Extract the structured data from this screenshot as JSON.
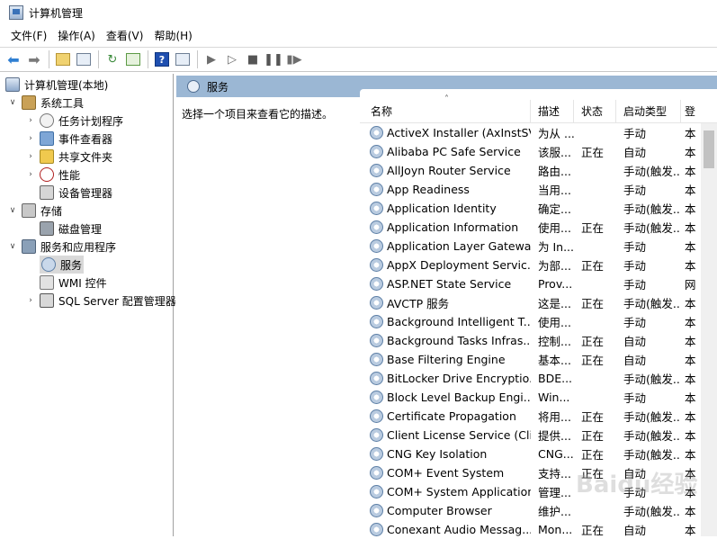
{
  "window": {
    "title": "计算机管理"
  },
  "menu": [
    "文件(F)",
    "操作(A)",
    "查看(V)",
    "帮助(H)"
  ],
  "tree": {
    "root": "计算机管理(本地)",
    "system_tools": "系统工具",
    "task_scheduler": "任务计划程序",
    "event_viewer": "事件查看器",
    "shared_folders": "共享文件夹",
    "performance": "性能",
    "device_manager": "设备管理器",
    "storage": "存储",
    "disk_management": "磁盘管理",
    "services_apps": "服务和应用程序",
    "services": "服务",
    "wmi": "WMI 控件",
    "sql_config": "SQL Server 配置管理器"
  },
  "pane": {
    "title": "服务",
    "description_hint": "选择一个项目来查看它的描述。"
  },
  "columns": {
    "name": "名称",
    "desc": "描述",
    "status": "状态",
    "startup": "启动类型",
    "logon": "登"
  },
  "services": [
    {
      "name": "ActiveX Installer (AxInstSV)",
      "desc": "为从 ...",
      "status": "",
      "startup": "手动",
      "logon": "本"
    },
    {
      "name": "Alibaba PC Safe Service",
      "desc": "该服...",
      "status": "正在",
      "startup": "自动",
      "logon": "本"
    },
    {
      "name": "AllJoyn Router Service",
      "desc": "路由...",
      "status": "",
      "startup": "手动(触发...",
      "logon": "本"
    },
    {
      "name": "App Readiness",
      "desc": "当用...",
      "status": "",
      "startup": "手动",
      "logon": "本"
    },
    {
      "name": "Application Identity",
      "desc": "确定...",
      "status": "",
      "startup": "手动(触发...",
      "logon": "本"
    },
    {
      "name": "Application Information",
      "desc": "使用...",
      "status": "正在",
      "startup": "手动(触发...",
      "logon": "本"
    },
    {
      "name": "Application Layer Gatewa...",
      "desc": "为 In...",
      "status": "",
      "startup": "手动",
      "logon": "本"
    },
    {
      "name": "AppX Deployment Servic...",
      "desc": "为部...",
      "status": "正在",
      "startup": "手动",
      "logon": "本"
    },
    {
      "name": "ASP.NET State Service",
      "desc": "Prov...",
      "status": "",
      "startup": "手动",
      "logon": "网"
    },
    {
      "name": "AVCTP 服务",
      "desc": "这是...",
      "status": "正在",
      "startup": "手动(触发...",
      "logon": "本"
    },
    {
      "name": "Background Intelligent T...",
      "desc": "使用...",
      "status": "",
      "startup": "手动",
      "logon": "本"
    },
    {
      "name": "Background Tasks Infras...",
      "desc": "控制...",
      "status": "正在",
      "startup": "自动",
      "logon": "本"
    },
    {
      "name": "Base Filtering Engine",
      "desc": "基本...",
      "status": "正在",
      "startup": "自动",
      "logon": "本"
    },
    {
      "name": "BitLocker Drive Encryptio...",
      "desc": "BDE...",
      "status": "",
      "startup": "手动(触发...",
      "logon": "本"
    },
    {
      "name": "Block Level Backup Engi...",
      "desc": "Win...",
      "status": "",
      "startup": "手动",
      "logon": "本"
    },
    {
      "name": "Certificate Propagation",
      "desc": "将用...",
      "status": "正在",
      "startup": "手动(触发...",
      "logon": "本"
    },
    {
      "name": "Client License Service (Cli...",
      "desc": "提供...",
      "status": "正在",
      "startup": "手动(触发...",
      "logon": "本"
    },
    {
      "name": "CNG Key Isolation",
      "desc": "CNG...",
      "status": "正在",
      "startup": "手动(触发...",
      "logon": "本"
    },
    {
      "name": "COM+ Event System",
      "desc": "支持...",
      "status": "正在",
      "startup": "自动",
      "logon": "本"
    },
    {
      "name": "COM+ System Application",
      "desc": "管理...",
      "status": "",
      "startup": "手动",
      "logon": "本"
    },
    {
      "name": "Computer Browser",
      "desc": "维护...",
      "status": "",
      "startup": "手动(触发...",
      "logon": "本"
    },
    {
      "name": "Conexant Audio Messag...",
      "desc": "Mon...",
      "status": "正在",
      "startup": "自动",
      "logon": "本"
    }
  ],
  "watermark": "Baidu经验"
}
